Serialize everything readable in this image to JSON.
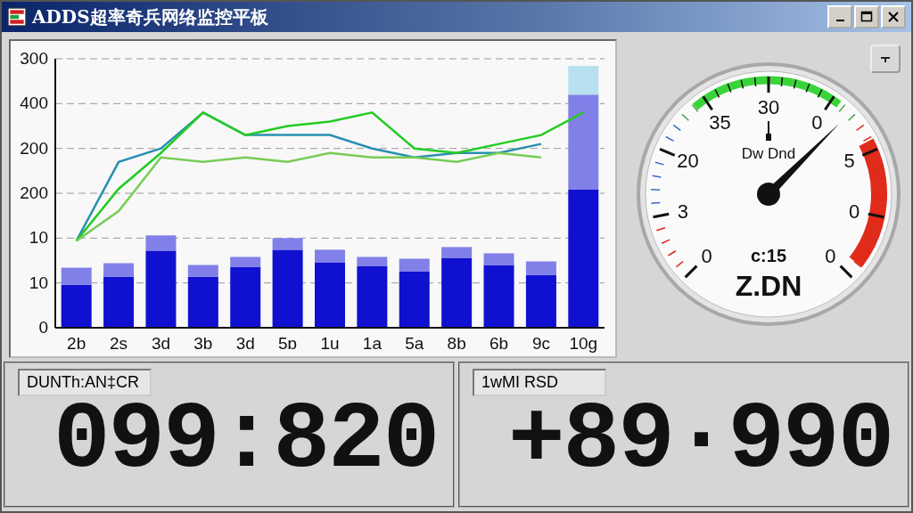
{
  "window": {
    "title": "ADDS超率奇兵网络监控平板"
  },
  "chart": {
    "y_axis_labels": [
      "300",
      "400",
      "200",
      "200",
      "10",
      "10",
      "0"
    ],
    "x_axis_labels": [
      "2b",
      "2s",
      "3d",
      "3b",
      "3d",
      "5ɒ",
      "1u",
      "1a",
      "5a",
      "8b",
      "6b",
      "9c",
      "10g"
    ]
  },
  "gauge": {
    "scale_labels": [
      "0",
      "3",
      "20",
      "35",
      "30",
      "0",
      "5",
      "0",
      "0"
    ],
    "unit": "Dw Dnd",
    "reading": "c:15",
    "caption": "Z.DN"
  },
  "panels": [
    {
      "label": "DUNTh:AN‡CR",
      "value": "099:820"
    },
    {
      "label": "1wMI RSD",
      "value": "+89·990"
    }
  ]
}
